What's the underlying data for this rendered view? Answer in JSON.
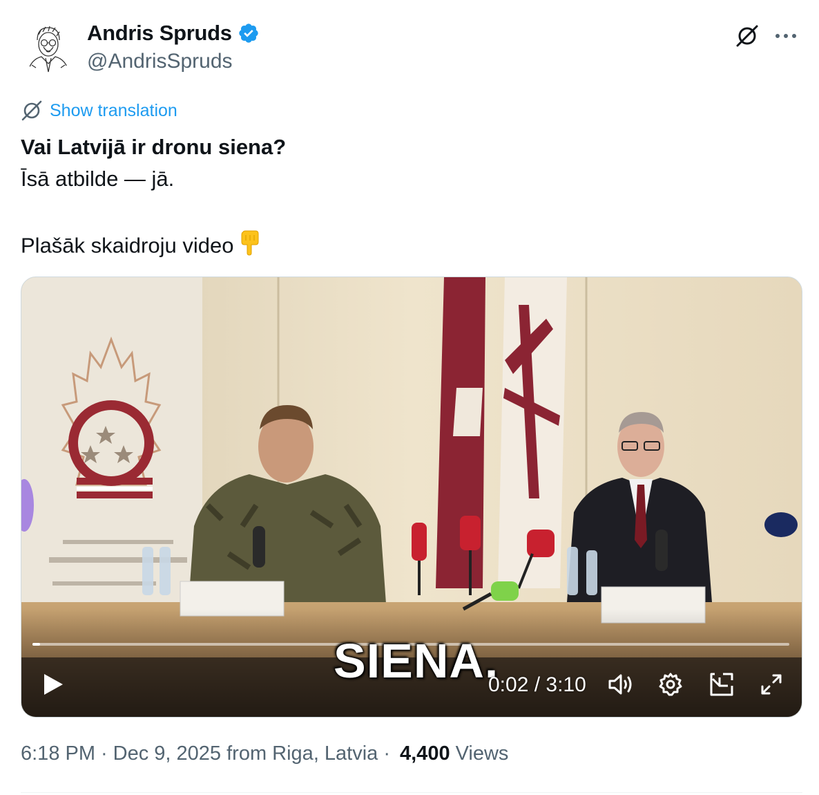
{
  "author": {
    "display_name": "Andris Spruds",
    "handle": "@AndrisSpruds",
    "verified": true,
    "verified_color": "#1d9bf0"
  },
  "header_actions": {
    "grok_icon": "grok-icon",
    "more_icon": "more-horizontal-icon"
  },
  "translate": {
    "label": "Show translation",
    "icon": "translate-icon",
    "color": "#1d9bf0"
  },
  "tweet": {
    "line1": "Vai Latvijā ir dronu siena?",
    "line2": "Īsā atbilde — jā.",
    "line3": "Plašāk skaidroju video",
    "emoji_icon": "pointing-down-hand-icon"
  },
  "video": {
    "caption": "SIENA.",
    "time_display": "0:02 / 3:10",
    "progress_fraction": 0.01,
    "controls": {
      "play_icon": "play-icon",
      "volume_icon": "volume-icon",
      "settings_icon": "gear-icon",
      "pip_icon": "picture-in-picture-icon",
      "fullscreen_icon": "fullscreen-icon"
    }
  },
  "meta": {
    "time": "6:18 PM",
    "separator1": "·",
    "date": "Dec 9, 2025 from Riga, Latvia",
    "separator2": "·",
    "views_count": "4,400",
    "views_label": "Views"
  }
}
